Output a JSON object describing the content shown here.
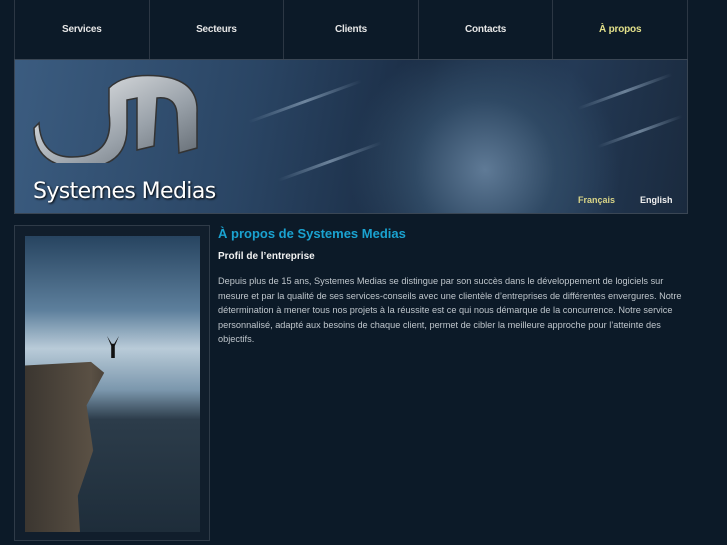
{
  "nav": {
    "items": [
      {
        "label": "Services"
      },
      {
        "label": "Secteurs"
      },
      {
        "label": "Clients"
      },
      {
        "label": "Contacts"
      },
      {
        "label": "À propos",
        "active": true
      }
    ]
  },
  "banner": {
    "brand": "Systemes Medias",
    "languages": [
      "Français",
      "English"
    ]
  },
  "content": {
    "title": "À propos de Systemes Medias",
    "subtitle": "Profil de l’entreprise",
    "paragraph": "Depuis plus de 15 ans, Systemes Medias se distingue par son succès dans le développement de logiciels sur mesure et par la qualité de ses services-conseils avec une clientèle d’entreprises de différentes envergures. Notre détermination à mener tous nos projets à la réussite est ce qui nous démarque de la concurrence. Notre service personnalisé, adapté aux besoins de chaque client, permet de cibler la meilleure approche pour l’atteinte des objectifs."
  },
  "colors": {
    "background": "#0c1a28",
    "title": "#1aa2d0",
    "active_nav": "#e2e08a"
  }
}
